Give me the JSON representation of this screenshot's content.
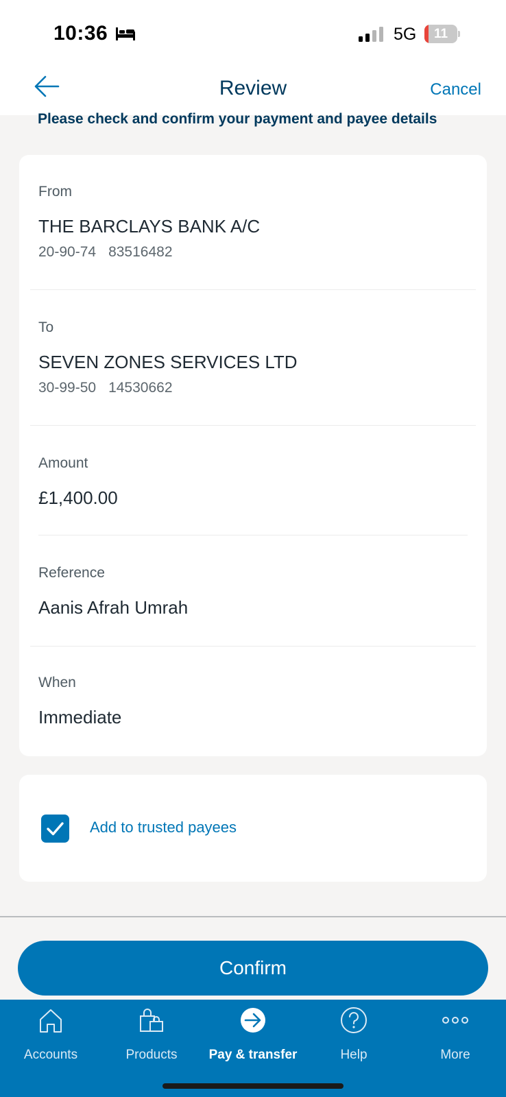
{
  "status_bar": {
    "time": "10:36",
    "network": "5G",
    "battery_level": "11",
    "battery_fraction": 0.11,
    "icons": [
      "bed-icon",
      "signal-icon",
      "battery-icon"
    ]
  },
  "nav": {
    "title": "Review",
    "cancel_label": "Cancel",
    "back_icon": "arrow-left-icon"
  },
  "instruction": "Please check and confirm your payment and payee details",
  "details": {
    "from": {
      "label": "From",
      "name": "THE BARCLAYS BANK A/C",
      "sort_code": "20-90-74",
      "account_number": "83516482"
    },
    "to": {
      "label": "To",
      "name": "SEVEN ZONES SERVICES LTD",
      "sort_code": "30-99-50",
      "account_number": "14530662"
    },
    "amount": {
      "label": "Amount",
      "value": "£1,400.00"
    },
    "reference": {
      "label": "Reference",
      "value": "Aanis Afrah Umrah"
    },
    "when": {
      "label": "When",
      "value": "Immediate"
    }
  },
  "trusted_payee": {
    "label": "Add to trusted payees",
    "checked": true
  },
  "confirm_label": "Confirm",
  "tabs": [
    {
      "label": "Accounts",
      "icon": "home-icon",
      "active": false
    },
    {
      "label": "Products",
      "icon": "shopping-bags-icon",
      "active": false
    },
    {
      "label": "Pay & transfer",
      "icon": "arrow-right-circle-icon",
      "active": true
    },
    {
      "label": "Help",
      "icon": "question-circle-icon",
      "active": false
    },
    {
      "label": "More",
      "icon": "more-dots-icon",
      "active": false
    }
  ],
  "colors": {
    "brand_blue": "#0076b6",
    "navy": "#00395d",
    "background": "#f5f4f3",
    "battery_low": "#e8443a"
  }
}
